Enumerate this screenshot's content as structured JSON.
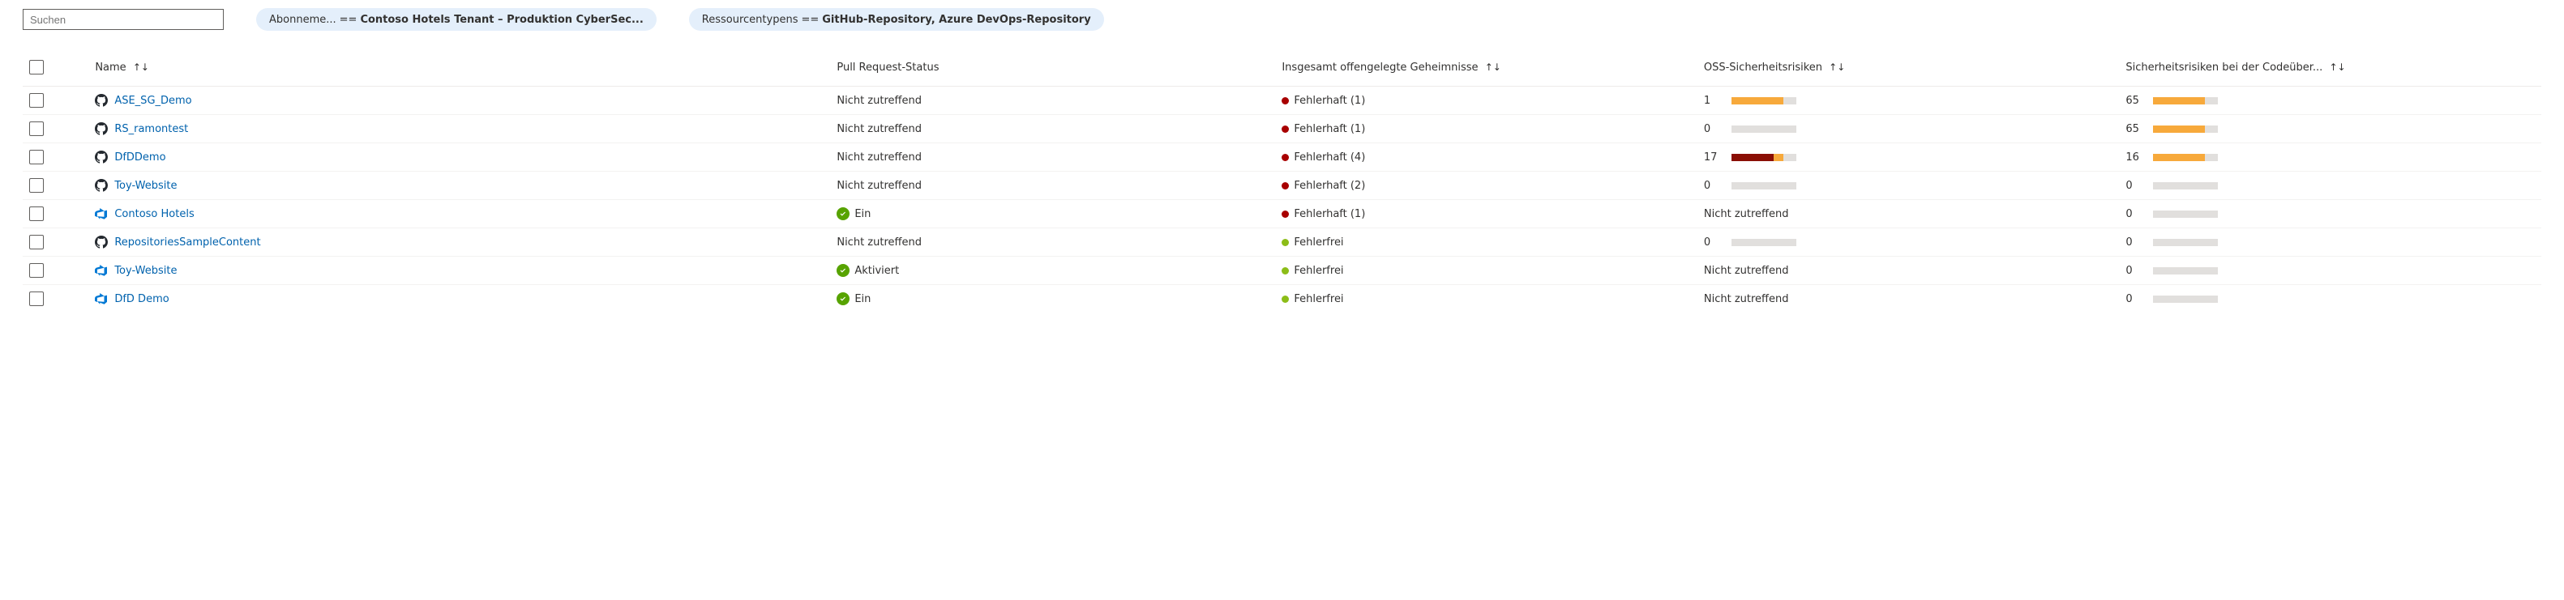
{
  "search": {
    "placeholder": "Suchen"
  },
  "filters": [
    {
      "label_prefix": "Abonneme...",
      "operator": "==",
      "value": "Contoso Hotels Tenant – Produktion CyberSec..."
    },
    {
      "label_prefix": "Ressourcentypens",
      "operator": "==",
      "value": "GitHub-Repository, Azure DevOps-Repository"
    }
  ],
  "columns": {
    "name": "Name",
    "pr": "Pull Request-Status",
    "secrets": "Insgesamt offengelegte Geheimnisse",
    "oss": "OSS-Sicherheitsrisiken",
    "code": "Sicherheitsrisiken bei der Codeüber..."
  },
  "sort_glyph": "↑↓",
  "status_labels": {
    "na": "Nicht zutreffend",
    "on": "Ein",
    "activated": "Aktiviert",
    "unhealthy": "Fehlerhaft",
    "healthy": "Fehlerfrei"
  },
  "rows": [
    {
      "icon": "github",
      "name": "ASE_SG_Demo",
      "pr_status": {
        "kind": "na"
      },
      "secrets": {
        "kind": "unhealthy",
        "count": 1
      },
      "oss": {
        "kind": "bar",
        "value": 1,
        "fill_pct": 80,
        "dark_pct": 0
      },
      "code": {
        "kind": "bar",
        "value": 65,
        "fill_pct": 80,
        "dark_pct": 0
      }
    },
    {
      "icon": "github",
      "name": "RS_ramontest",
      "pr_status": {
        "kind": "na"
      },
      "secrets": {
        "kind": "unhealthy",
        "count": 1
      },
      "oss": {
        "kind": "bar",
        "value": 0,
        "fill_pct": 0,
        "dark_pct": 0
      },
      "code": {
        "kind": "bar",
        "value": 65,
        "fill_pct": 80,
        "dark_pct": 0
      }
    },
    {
      "icon": "github",
      "name": "DfDDemo",
      "pr_status": {
        "kind": "na"
      },
      "secrets": {
        "kind": "unhealthy",
        "count": 4
      },
      "oss": {
        "kind": "bar",
        "value": 17,
        "fill_pct": 80,
        "dark_pct": 65
      },
      "code": {
        "kind": "bar",
        "value": 16,
        "fill_pct": 80,
        "dark_pct": 0
      }
    },
    {
      "icon": "github",
      "name": "Toy-Website",
      "pr_status": {
        "kind": "na"
      },
      "secrets": {
        "kind": "unhealthy",
        "count": 2
      },
      "oss": {
        "kind": "bar",
        "value": 0,
        "fill_pct": 0,
        "dark_pct": 0
      },
      "code": {
        "kind": "bar",
        "value": 0,
        "fill_pct": 0,
        "dark_pct": 0
      }
    },
    {
      "icon": "azdo",
      "name": "Contoso Hotels",
      "pr_status": {
        "kind": "on"
      },
      "secrets": {
        "kind": "unhealthy",
        "count": 1
      },
      "oss": {
        "kind": "na"
      },
      "code": {
        "kind": "bar",
        "value": 0,
        "fill_pct": 0,
        "dark_pct": 0
      }
    },
    {
      "icon": "github",
      "name": "RepositoriesSampleContent",
      "pr_status": {
        "kind": "na"
      },
      "secrets": {
        "kind": "healthy"
      },
      "oss": {
        "kind": "bar",
        "value": 0,
        "fill_pct": 0,
        "dark_pct": 0
      },
      "code": {
        "kind": "bar",
        "value": 0,
        "fill_pct": 0,
        "dark_pct": 0
      }
    },
    {
      "icon": "azdo",
      "name": "Toy-Website",
      "pr_status": {
        "kind": "activated"
      },
      "secrets": {
        "kind": "healthy"
      },
      "oss": {
        "kind": "na"
      },
      "code": {
        "kind": "bar",
        "value": 0,
        "fill_pct": 0,
        "dark_pct": 0
      }
    },
    {
      "icon": "azdo",
      "name": "DfD Demo",
      "pr_status": {
        "kind": "on"
      },
      "secrets": {
        "kind": "healthy"
      },
      "oss": {
        "kind": "na"
      },
      "code": {
        "kind": "bar",
        "value": 0,
        "fill_pct": 0,
        "dark_pct": 0
      }
    }
  ]
}
